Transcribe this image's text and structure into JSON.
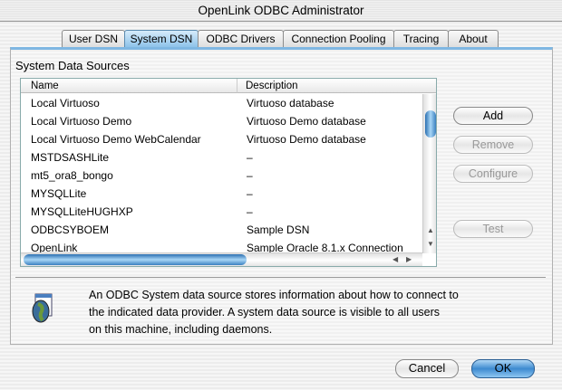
{
  "window": {
    "title": "OpenLink ODBC Administrator"
  },
  "tabs": [
    {
      "label": "User DSN"
    },
    {
      "label": "System DSN",
      "selected": true
    },
    {
      "label": "ODBC Drivers"
    },
    {
      "label": "Connection Pooling"
    },
    {
      "label": "Tracing"
    },
    {
      "label": "About"
    }
  ],
  "section": {
    "title": "System Data Sources"
  },
  "table": {
    "columns": [
      "Name",
      "Description"
    ],
    "rows": [
      {
        "name": "Local Virtuoso",
        "description": "Virtuoso database"
      },
      {
        "name": "Local Virtuoso Demo",
        "description": "Virtuoso Demo database"
      },
      {
        "name": "Local Virtuoso Demo WebCalendar",
        "description": "Virtuoso Demo database"
      },
      {
        "name": "MSTDSASHLite",
        "description": "–"
      },
      {
        "name": "mt5_ora8_bongo",
        "description": "–"
      },
      {
        "name": "MYSQLLite",
        "description": "–"
      },
      {
        "name": "MYSQLLiteHUGHXP",
        "description": "–"
      },
      {
        "name": "ODBCSYBOEM",
        "description": "Sample DSN"
      },
      {
        "name": "OpenLink",
        "description": "Sample Oracle 8.1.x Connection"
      }
    ]
  },
  "buttons": {
    "add": "Add",
    "remove": "Remove",
    "configure": "Configure",
    "test": "Test",
    "cancel": "Cancel",
    "ok": "OK"
  },
  "info": {
    "lines": [
      "An ODBC System data source stores information about how to connect to",
      "the indicated data provider. A system data source is visible to all users",
      "on this machine, including daemons."
    ]
  }
}
